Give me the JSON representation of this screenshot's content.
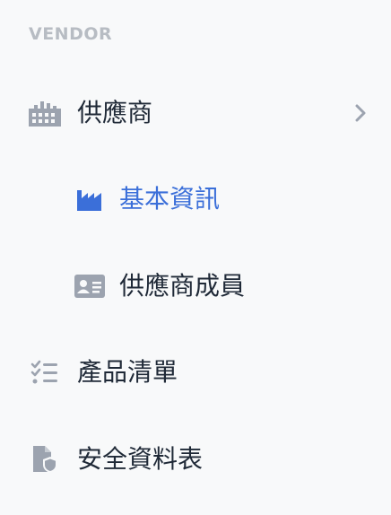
{
  "sidebar": {
    "section_label": "VENDOR",
    "items": [
      {
        "label": "供應商",
        "icon": "building-icon",
        "expandable": true
      },
      {
        "label": "基本資訊",
        "icon": "factory-icon",
        "active": true
      },
      {
        "label": "供應商成員",
        "icon": "id-card-icon"
      },
      {
        "label": "產品清單",
        "icon": "checklist-icon"
      },
      {
        "label": "安全資料表",
        "icon": "file-shield-icon"
      }
    ]
  },
  "colors": {
    "background": "#f8f9fa",
    "text": "#1f2937",
    "muted_icon": "#9ca3af",
    "section_label": "#b7bcc3",
    "active": "#3b6fd9"
  }
}
